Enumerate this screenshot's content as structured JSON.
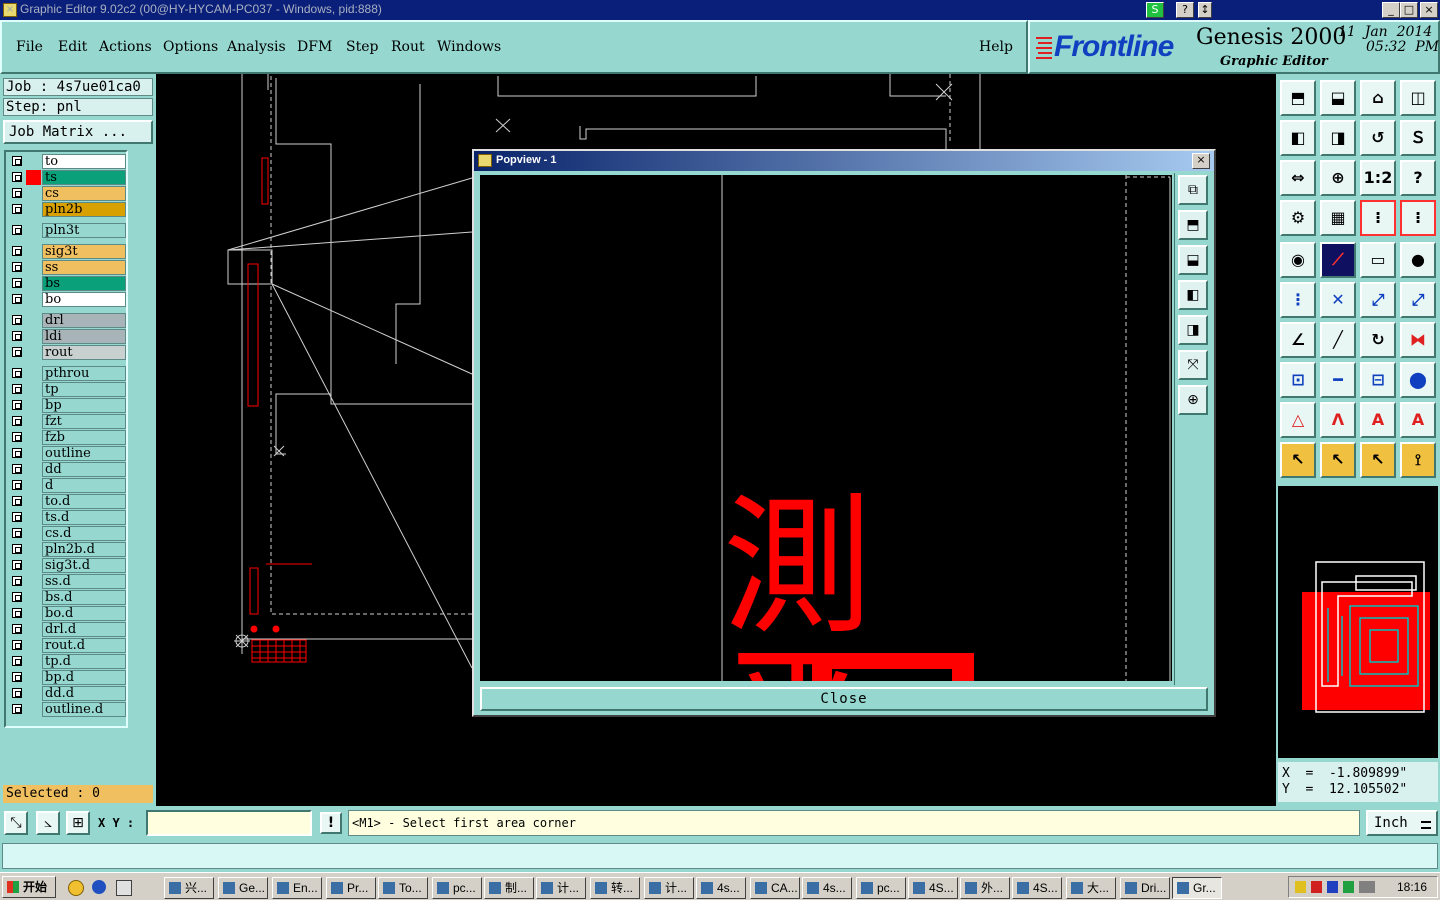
{
  "window": {
    "title": "Graphic Editor 9.02c2 (00@HY-HYCAM-PC037 - Windows, pid:888)",
    "sys_buttons": [
      "S",
      "?",
      "↕"
    ],
    "ctrl_buttons": [
      "_",
      "□",
      "×"
    ]
  },
  "menubar": {
    "items": [
      "File",
      "Edit",
      "Actions",
      "Options",
      "Analysis",
      "DFM",
      "Step",
      "Rout",
      "Windows"
    ],
    "help": "Help"
  },
  "brand": {
    "logo": "Frontline",
    "product": "Genesis 2000",
    "subtitle": "Graphic Editor",
    "date": "11  Jan  2014",
    "time": "05:32  PM"
  },
  "left": {
    "job_label": "Job : 4s7ue01ca0",
    "step_label": "Step: pnl",
    "job_matrix": "Job Matrix ...",
    "selected": "Selected : 0",
    "layers": [
      {
        "name": "to",
        "color": "#ffffff"
      },
      {
        "name": "ts",
        "color": "#0aa07a",
        "active": true
      },
      {
        "name": "cs",
        "color": "#f0c060"
      },
      {
        "name": "pln2b",
        "color": "#d8a000"
      },
      {
        "name": "pln3t",
        "color": "#96d8d0"
      },
      {
        "name": "sig3t",
        "color": "#f0c060"
      },
      {
        "name": "ss",
        "color": "#f0c060"
      },
      {
        "name": "bs",
        "color": "#0aa07a"
      },
      {
        "name": "bo",
        "color": "#ffffff"
      },
      {
        "name": "drl",
        "color": "#a8b4b8"
      },
      {
        "name": "ldi",
        "color": "#a8b4b8"
      },
      {
        "name": "rout",
        "color": "#c8d0d0"
      },
      {
        "name": "pthrou",
        "color": "#96d8d0"
      },
      {
        "name": "tp",
        "color": "#96d8d0"
      },
      {
        "name": "bp",
        "color": "#96d8d0"
      },
      {
        "name": "fzt",
        "color": "#96d8d0"
      },
      {
        "name": "fzb",
        "color": "#96d8d0"
      },
      {
        "name": "outline",
        "color": "#96d8d0"
      },
      {
        "name": "dd",
        "color": "#96d8d0"
      },
      {
        "name": "d",
        "color": "#96d8d0"
      },
      {
        "name": "to.d",
        "color": "#96d8d0"
      },
      {
        "name": "ts.d",
        "color": "#96d8d0"
      },
      {
        "name": "cs.d",
        "color": "#96d8d0"
      },
      {
        "name": "pln2b.d",
        "color": "#96d8d0"
      },
      {
        "name": "sig3t.d",
        "color": "#96d8d0"
      },
      {
        "name": "ss.d",
        "color": "#96d8d0"
      },
      {
        "name": "bs.d",
        "color": "#96d8d0"
      },
      {
        "name": "bo.d",
        "color": "#96d8d0"
      },
      {
        "name": "drl.d",
        "color": "#96d8d0"
      },
      {
        "name": "rout.d",
        "color": "#96d8d0"
      },
      {
        "name": "tp.d",
        "color": "#96d8d0"
      },
      {
        "name": "bp.d",
        "color": "#96d8d0"
      },
      {
        "name": "dd.d",
        "color": "#96d8d0"
      },
      {
        "name": "outline.d",
        "color": "#96d8d0"
      }
    ]
  },
  "popview": {
    "title": "Popview - 1",
    "close_label": "Close",
    "glyphs": "測平"
  },
  "coords": {
    "x": "X  =  -1.809899\"",
    "y": "Y  =  12.105502\""
  },
  "command": {
    "xy_label": "X Y :",
    "input_value": "",
    "bang": "!",
    "prompt": "<M1> - Select first area corner",
    "units": "Inch"
  },
  "taskbar": {
    "start": "开始",
    "tasks": [
      "兴...",
      "Ge...",
      "En...",
      "Pr...",
      "To...",
      "pc...",
      "制...",
      "计...",
      "转...",
      "计...",
      "4s...",
      "CA...",
      "4s...",
      "pc...",
      "4S...",
      "外...",
      "4S...",
      "大...",
      "Dri...",
      "Gr..."
    ],
    "clock": "18:16"
  },
  "colors": {
    "panel": "#96d8d0",
    "red": "#ff0000",
    "canvas": "#000000"
  }
}
